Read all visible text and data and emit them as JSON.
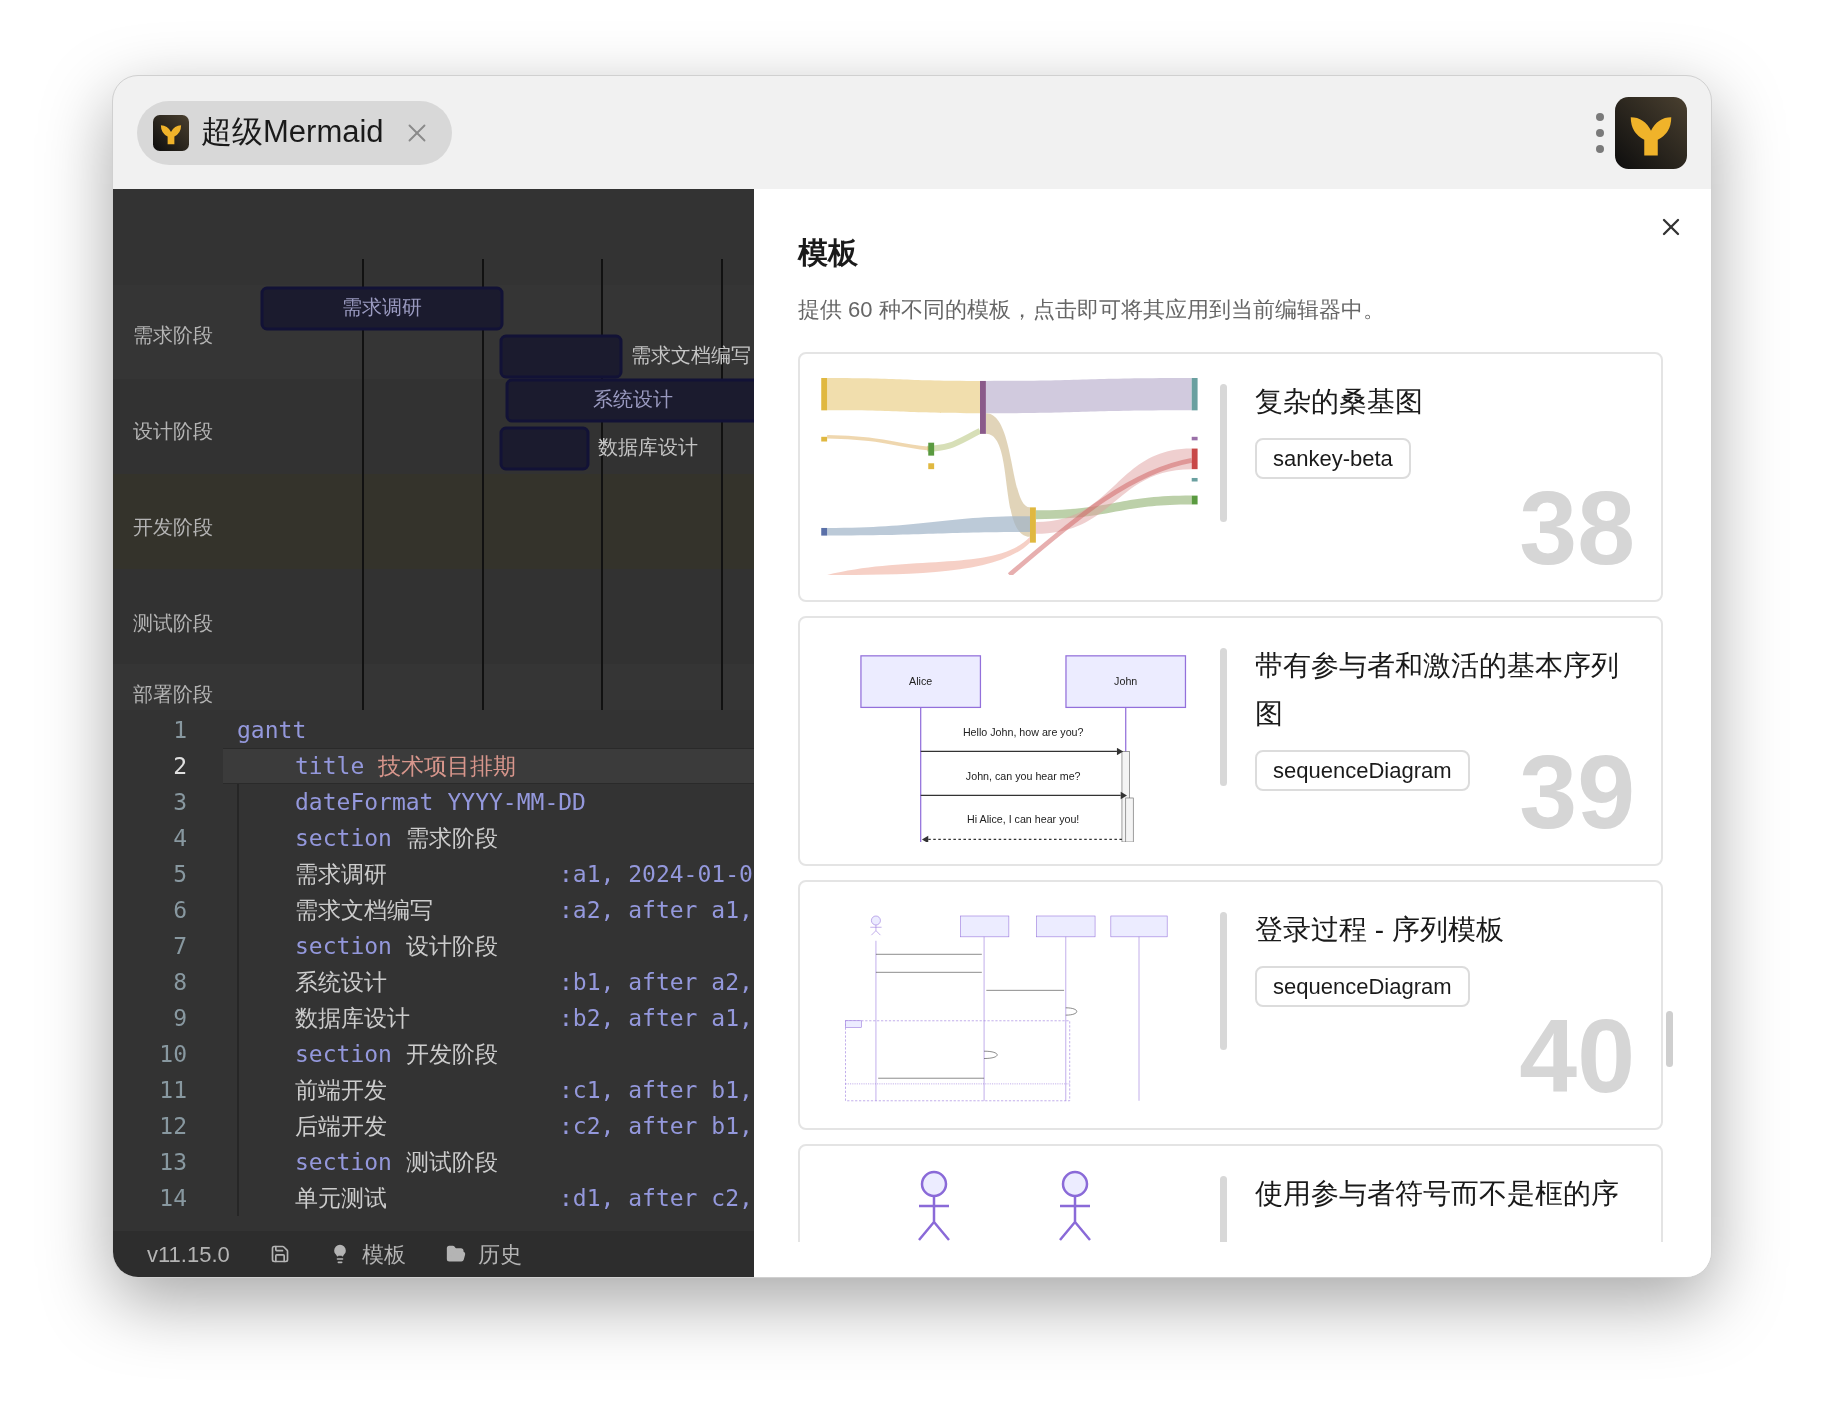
{
  "tab": {
    "title": "超级Mermaid"
  },
  "gantt": {
    "sections": [
      {
        "name": "需求阶段",
        "tasks": [
          {
            "label": "需求调研",
            "label_inside": true
          },
          {
            "label": "需求文档编写",
            "label_inside": false
          }
        ]
      },
      {
        "name": "设计阶段",
        "tasks": [
          {
            "label": "系统设计",
            "label_inside": true
          },
          {
            "label": "数据库设计",
            "label_inside": false
          }
        ]
      },
      {
        "name": "开发阶段"
      },
      {
        "name": "测试阶段"
      },
      {
        "name": "部署阶段"
      }
    ]
  },
  "code": {
    "lines": [
      {
        "number": "1",
        "current": false,
        "tokens": [
          {
            "kind": "keyword",
            "text": "gantt"
          }
        ],
        "children": [
          {
            "number": "2",
            "current": true,
            "tokens": [
              {
                "kind": "keyword",
                "text": "title"
              },
              {
                "kind": "string",
                "text": "技术项目排期"
              }
            ]
          },
          {
            "number": "3",
            "current": false,
            "tokens": [
              {
                "kind": "keyword",
                "text": "dateFormat"
              },
              {
                "kind": "keyword",
                "text": "YYYY-MM-DD"
              }
            ]
          },
          {
            "number": "4",
            "current": false,
            "tokens": [
              {
                "kind": "keyword",
                "text": "section"
              },
              {
                "kind": "text",
                "text": "需求阶段"
              }
            ]
          },
          {
            "number": "5",
            "current": false,
            "tokens": [
              {
                "kind": "task",
                "text": "需求调研"
              },
              {
                "kind": "spec",
                "text": ":a1, 2024-01-0"
              }
            ]
          },
          {
            "number": "6",
            "current": false,
            "tokens": [
              {
                "kind": "task",
                "text": "需求文档编写"
              },
              {
                "kind": "spec",
                "text": ":a2, after a1,"
              }
            ]
          },
          {
            "number": "7",
            "current": false,
            "tokens": [
              {
                "kind": "keyword",
                "text": "section"
              },
              {
                "kind": "text",
                "text": "设计阶段"
              }
            ]
          },
          {
            "number": "8",
            "current": false,
            "tokens": [
              {
                "kind": "task",
                "text": "系统设计"
              },
              {
                "kind": "spec",
                "text": ":b1, after a2,"
              }
            ]
          },
          {
            "number": "9",
            "current": false,
            "tokens": [
              {
                "kind": "task",
                "text": "数据库设计"
              },
              {
                "kind": "spec",
                "text": ":b2, after a1,"
              }
            ]
          },
          {
            "number": "10",
            "current": false,
            "tokens": [
              {
                "kind": "keyword",
                "text": "section"
              },
              {
                "kind": "text",
                "text": "开发阶段"
              }
            ]
          },
          {
            "number": "11",
            "current": false,
            "tokens": [
              {
                "kind": "task",
                "text": "前端开发"
              },
              {
                "kind": "spec",
                "text": ":c1, after b1,"
              }
            ]
          },
          {
            "number": "12",
            "current": false,
            "tokens": [
              {
                "kind": "task",
                "text": "后端开发"
              },
              {
                "kind": "spec",
                "text": ":c2, after b1,"
              }
            ]
          },
          {
            "number": "13",
            "current": false,
            "tokens": [
              {
                "kind": "keyword",
                "text": "section"
              },
              {
                "kind": "text",
                "text": "测试阶段"
              }
            ]
          },
          {
            "number": "14",
            "current": false,
            "tokens": [
              {
                "kind": "task",
                "text": "单元测试"
              },
              {
                "kind": "spec",
                "text": ":d1, after c2,"
              }
            ]
          }
        ]
      }
    ]
  },
  "status_bar": [
    {
      "kind": "version",
      "text": "v11.15.0"
    },
    {
      "kind": "save"
    },
    {
      "kind": "templates",
      "text": "模板"
    },
    {
      "kind": "history",
      "text": "历史"
    }
  ],
  "panel": {
    "title": "模板",
    "description": "提供 60 种不同的模板，点击即可将其应用到当前编辑器中。",
    "templates": [
      {
        "number": "38",
        "title": "复杂的桑基图",
        "tag": "sankey-beta",
        "preview": {
          "kind": "sankey"
        }
      },
      {
        "number": "39",
        "title": "带有参与者和激活的基本序列图",
        "tag": "sequenceDiagram",
        "preview": {
          "kind": "sequence",
          "labels": [
            "Alice",
            "John",
            "Hello John, how are you?",
            "John, can you hear me?",
            "Hi Alice, I can hear you!"
          ]
        }
      },
      {
        "number": "40",
        "title": "登录过程 - 序列模板",
        "tag": "sequenceDiagram",
        "preview": {
          "kind": "login"
        }
      },
      {
        "title": "使用参与者符号而不是框的序",
        "preview": {
          "kind": "actors"
        }
      }
    ]
  }
}
